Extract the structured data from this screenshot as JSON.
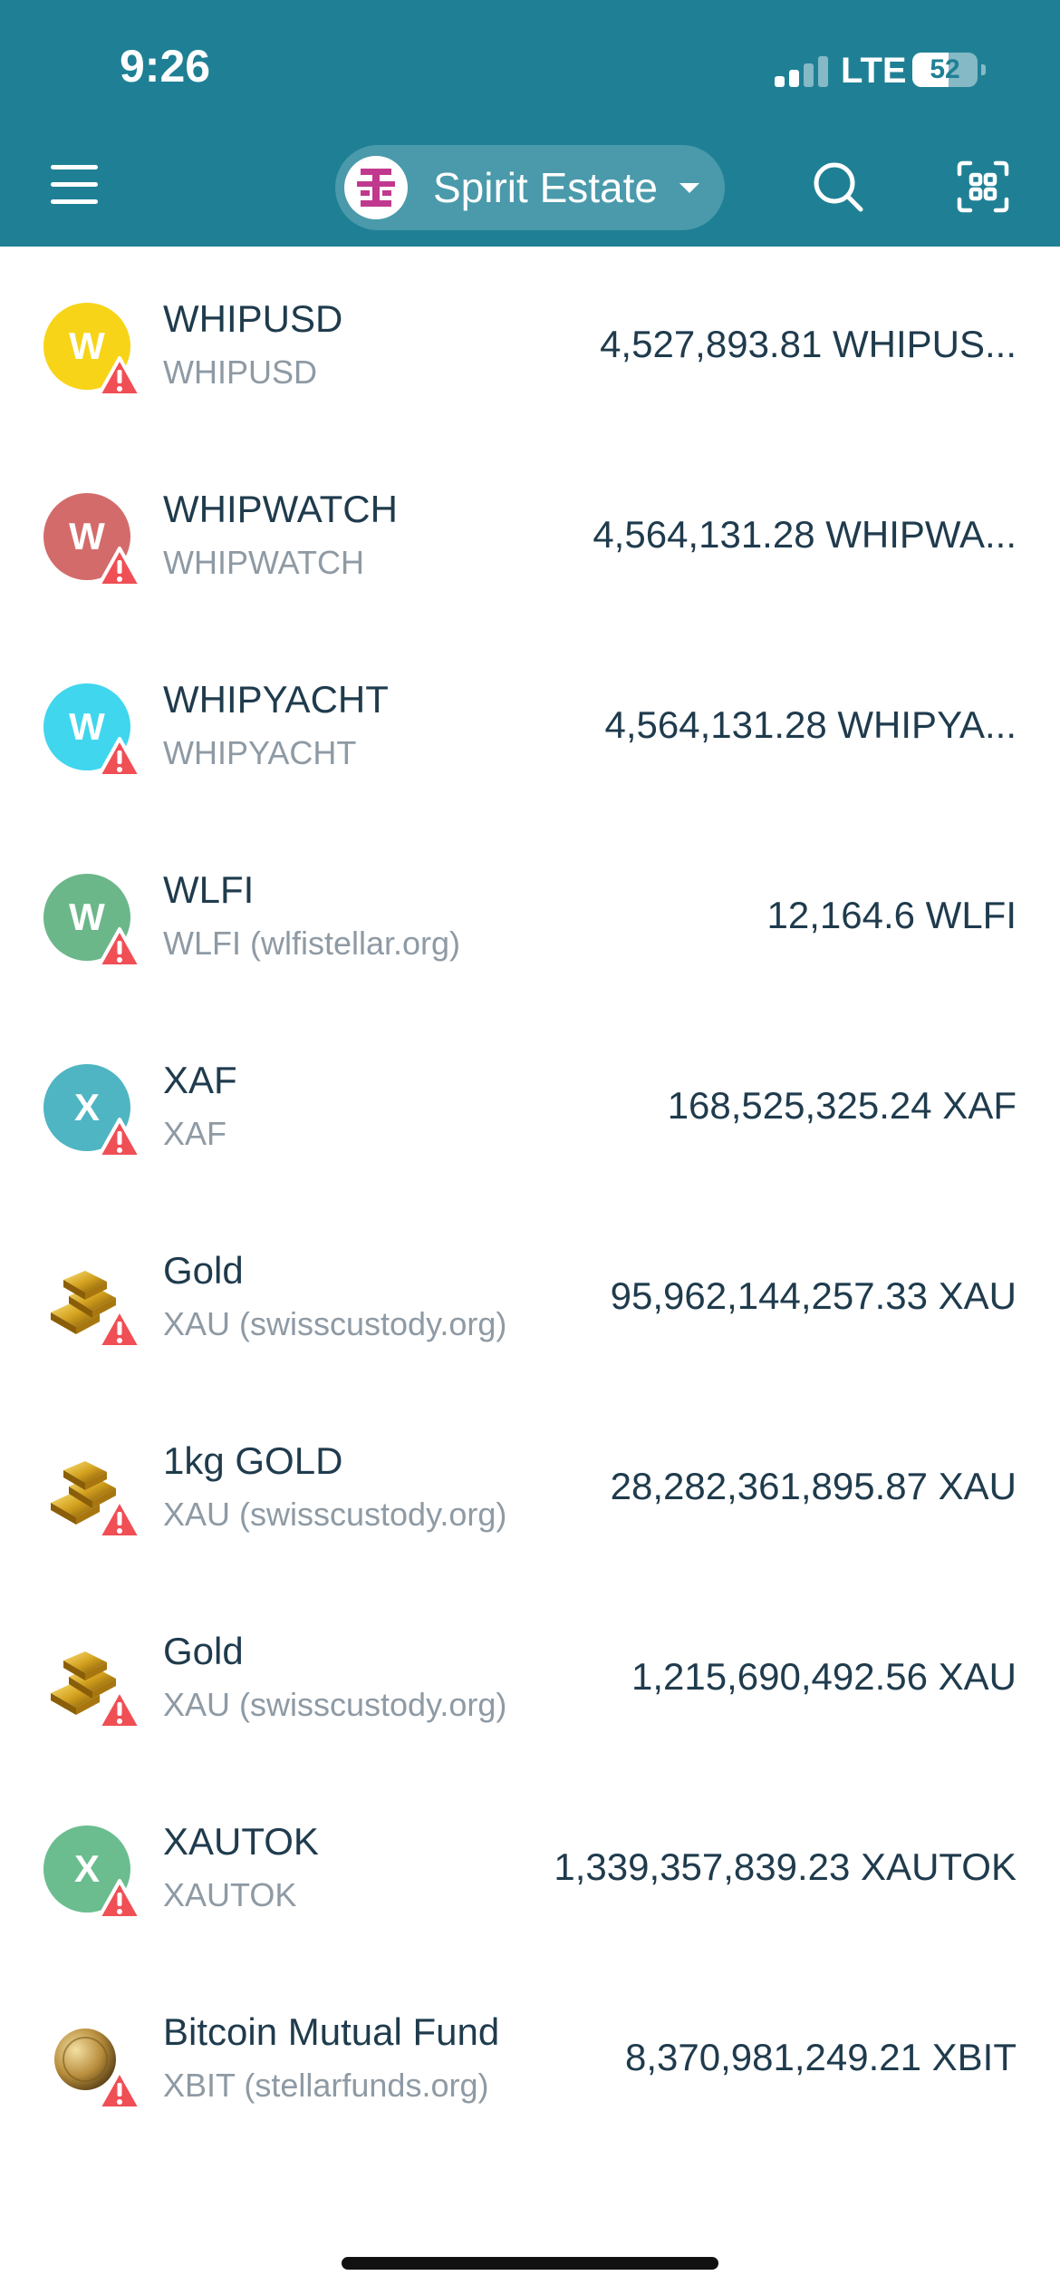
{
  "status_bar": {
    "time": "9:26",
    "network": "LTE",
    "battery": "52"
  },
  "header": {
    "account_name": "Spirit Estate",
    "accent_color": "#1f8095",
    "icons": [
      "menu-icon",
      "account-avatar",
      "chevron-down-icon",
      "search-icon",
      "qr-scan-icon"
    ]
  },
  "assets": [
    {
      "letter": "W",
      "icon_type": "letter",
      "color": "#f7d417",
      "name": "WHIPUSD",
      "sub": "WHIPUSD",
      "balance": "4,527,893.81 WHIPUS..."
    },
    {
      "letter": "W",
      "icon_type": "letter",
      "color": "#d46b6b",
      "name": "WHIPWATCH",
      "sub": "WHIPWATCH",
      "balance": "4,564,131.28 WHIPWA..."
    },
    {
      "letter": "W",
      "icon_type": "letter",
      "color": "#3fd6ee",
      "name": "WHIPYACHT",
      "sub": "WHIPYACHT",
      "balance": "4,564,131.28 WHIPYA..."
    },
    {
      "letter": "W",
      "icon_type": "letter",
      "color": "#6bb78a",
      "name": "WLFI",
      "sub": "WLFI (wlfistellar.org)",
      "balance": "12,164.6 WLFI"
    },
    {
      "letter": "X",
      "icon_type": "letter",
      "color": "#4fb5c2",
      "name": "XAF",
      "sub": "XAF",
      "balance": "168,525,325.24 XAF"
    },
    {
      "letter": "",
      "icon_type": "gold",
      "color": "#c89a1c",
      "name": "Gold",
      "sub": "XAU (swisscustody.org)",
      "balance": "95,962,144,257.33 XAU"
    },
    {
      "letter": "",
      "icon_type": "gold",
      "color": "#c89a1c",
      "name": "1kg GOLD",
      "sub": "XAU (swisscustody.org)",
      "balance": "28,282,361,895.87 XAU"
    },
    {
      "letter": "",
      "icon_type": "gold",
      "color": "#c89a1c",
      "name": "Gold",
      "sub": "XAU (swisscustody.org)",
      "balance": "1,215,690,492.56 XAU"
    },
    {
      "letter": "X",
      "icon_type": "letter",
      "color": "#6bbd8f",
      "name": "XAUTOK",
      "sub": "XAUTOK",
      "balance": "1,339,357,839.23 XAUTOK"
    },
    {
      "letter": "",
      "icon_type": "coin",
      "color": "#b08a3e",
      "name": "Bitcoin Mutual Fund",
      "sub": "XBIT (stellarfunds.org)",
      "balance": "8,370,981,249.21 XBIT"
    }
  ],
  "warning_color": "#ef4f55"
}
